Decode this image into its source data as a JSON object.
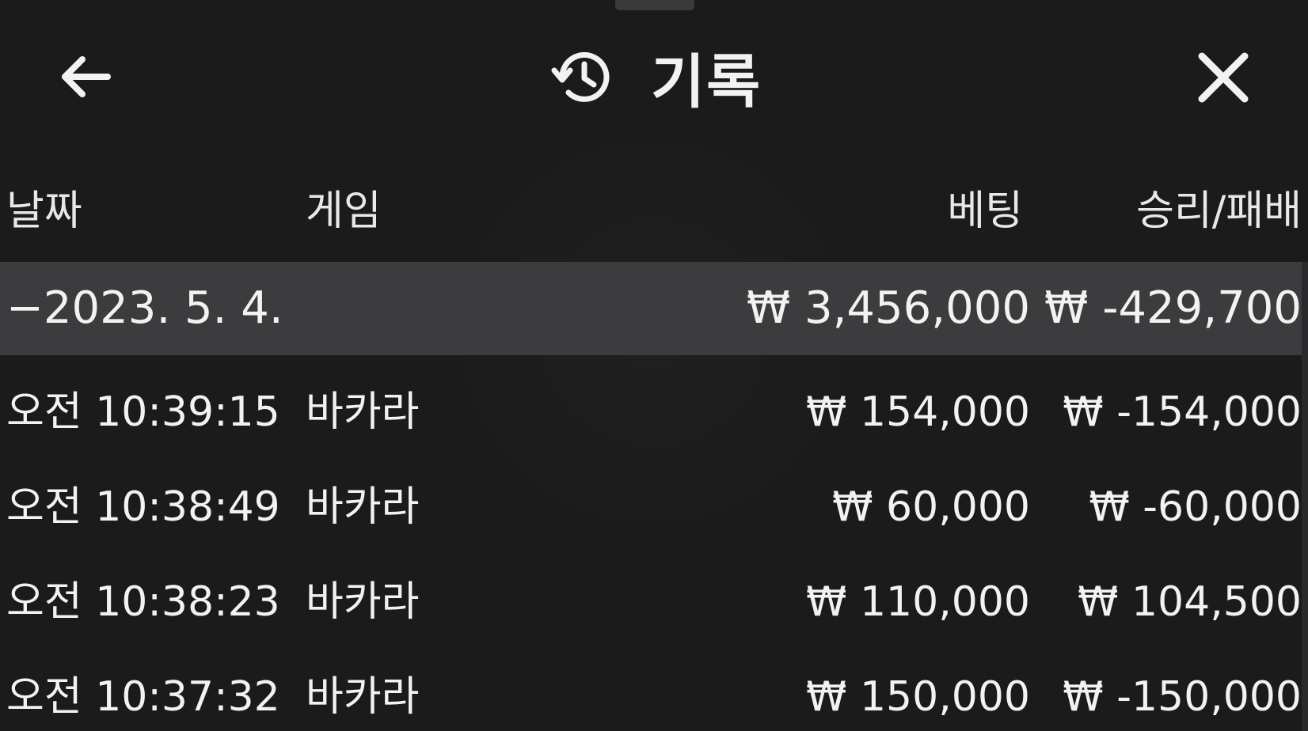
{
  "header": {
    "title": "기록",
    "back_icon": "arrow-left-icon",
    "history_icon": "history-clock-icon",
    "close_icon": "close-icon"
  },
  "columns": {
    "date": "날짜",
    "game": "게임",
    "bet": "베팅",
    "result": "승리/패배"
  },
  "summary": {
    "date": "−2023. 5. 4.",
    "bet": "₩ 3,456,000",
    "result": "₩ -429,700"
  },
  "rows": [
    {
      "time": "오전 10:39:15",
      "game": "바카라",
      "bet": "₩ 154,000",
      "result": "₩ -154,000"
    },
    {
      "time": "오전 10:38:49",
      "game": "바카라",
      "bet": "₩ 60,000",
      "result": "₩ -60,000"
    },
    {
      "time": "오전 10:38:23",
      "game": "바카라",
      "bet": "₩ 110,000",
      "result": "₩ 104,500"
    },
    {
      "time": "오전 10:37:32",
      "game": "바카라",
      "bet": "₩ 150,000",
      "result": "₩ -150,000"
    }
  ],
  "colors": {
    "background": "#1b1b1c",
    "summary_row": "#3c3c3e",
    "text": "#f2f2f2"
  }
}
